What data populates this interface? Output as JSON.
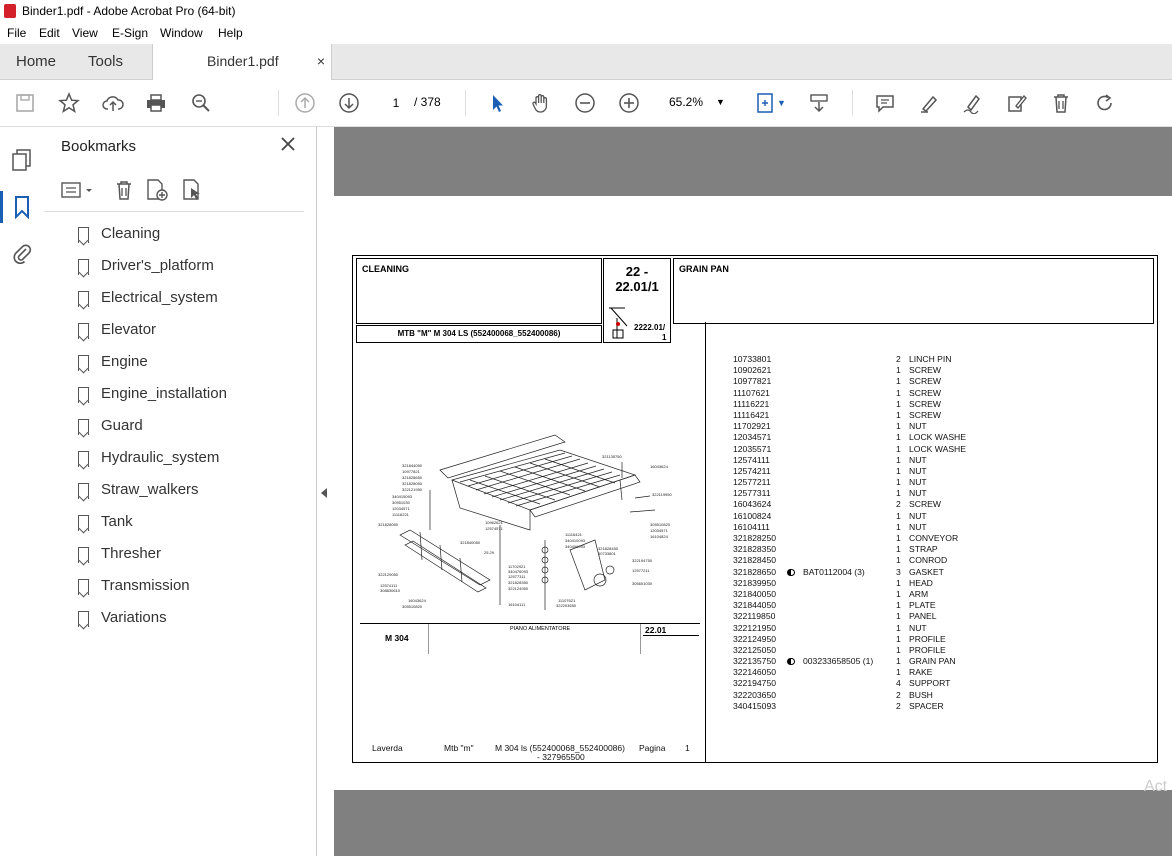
{
  "window": {
    "title": "Binder1.pdf - Adobe Acrobat Pro (64-bit)"
  },
  "menu": [
    "File",
    "Edit",
    "View",
    "E-Sign",
    "Window",
    "Help"
  ],
  "tabs": {
    "home": "Home",
    "tools": "Tools",
    "doc": "Binder1.pdf",
    "close": "×"
  },
  "toolbar": {
    "page_current": "1",
    "page_total": "/  378",
    "zoom": "65.2%"
  },
  "bookmarks": {
    "title": "Bookmarks",
    "items": [
      "Cleaning",
      "Driver's_platform",
      "Electrical_system",
      "Elevator",
      "Engine",
      "Engine_installation",
      "Guard",
      "Hydraulic_system",
      "Straw_walkers",
      "Tank",
      "Thresher",
      "Transmission",
      "Variations"
    ]
  },
  "sheet": {
    "group": "CLEANING",
    "code_top": "22 -",
    "code_bottom": "22.01/1",
    "title": "GRAIN PAN",
    "model": "MTB \"M\" M 304 LS (552400068_552400086)",
    "ref": "2222.01/",
    "ref2": "1",
    "drawing_model": "M 304",
    "drawing_title": "PIANO ALIMENTATORE",
    "drawing_code": "22.01",
    "footer": {
      "brand": "Laverda",
      "series": "Mtb \"m\"",
      "model": "M 304 ls (552400068_552400086)",
      "model2": "- 327965500",
      "page_label": "Pagina",
      "page_num": "1"
    }
  },
  "parts": [
    {
      "code": "10733801",
      "bat": "",
      "qty": "2",
      "desc": "LINCH PIN"
    },
    {
      "code": "10902621",
      "bat": "",
      "qty": "1",
      "desc": "SCREW"
    },
    {
      "code": "10977821",
      "bat": "",
      "qty": "1",
      "desc": "SCREW"
    },
    {
      "code": "11107621",
      "bat": "",
      "qty": "1",
      "desc": "SCREW"
    },
    {
      "code": "11116221",
      "bat": "",
      "qty": "1",
      "desc": "SCREW"
    },
    {
      "code": "11116421",
      "bat": "",
      "qty": "1",
      "desc": "SCREW"
    },
    {
      "code": "11702921",
      "bat": "",
      "qty": "1",
      "desc": "NUT"
    },
    {
      "code": "12034571",
      "bat": "",
      "qty": "1",
      "desc": "LOCK WASHE"
    },
    {
      "code": "12035571",
      "bat": "",
      "qty": "1",
      "desc": "LOCK WASHE"
    },
    {
      "code": "12574111",
      "bat": "",
      "qty": "1",
      "desc": "NUT"
    },
    {
      "code": "12574211",
      "bat": "",
      "qty": "1",
      "desc": "NUT"
    },
    {
      "code": "12577211",
      "bat": "",
      "qty": "1",
      "desc": "NUT"
    },
    {
      "code": "12577311",
      "bat": "",
      "qty": "1",
      "desc": "NUT"
    },
    {
      "code": "16043624",
      "bat": "",
      "qty": "2",
      "desc": "SCREW"
    },
    {
      "code": "16100824",
      "bat": "",
      "qty": "1",
      "desc": "NUT"
    },
    {
      "code": "16104111",
      "bat": "",
      "qty": "1",
      "desc": "NUT"
    },
    {
      "code": "321828250",
      "bat": "",
      "qty": "1",
      "desc": "CONVEYOR"
    },
    {
      "code": "321828350",
      "bat": "",
      "qty": "1",
      "desc": "STRAP"
    },
    {
      "code": "321828450",
      "bat": "",
      "qty": "1",
      "desc": "CONROD"
    },
    {
      "code": "321828650",
      "bat": "BAT0112004  (3)",
      "qty": "3",
      "desc": "GASKET"
    },
    {
      "code": "321839950",
      "bat": "",
      "qty": "1",
      "desc": "HEAD"
    },
    {
      "code": "321840050",
      "bat": "",
      "qty": "1",
      "desc": "ARM"
    },
    {
      "code": "321844050",
      "bat": "",
      "qty": "1",
      "desc": "PLATE"
    },
    {
      "code": "322119850",
      "bat": "",
      "qty": "1",
      "desc": "PANEL"
    },
    {
      "code": "322121950",
      "bat": "",
      "qty": "1",
      "desc": "NUT"
    },
    {
      "code": "322124950",
      "bat": "",
      "qty": "1",
      "desc": "PROFILE"
    },
    {
      "code": "322125050",
      "bat": "",
      "qty": "1",
      "desc": "PROFILE"
    },
    {
      "code": "322135750",
      "bat": "003233658505  (1)",
      "qty": "1",
      "desc": "GRAIN PAN"
    },
    {
      "code": "322146050",
      "bat": "",
      "qty": "1",
      "desc": "RAKE"
    },
    {
      "code": "322194750",
      "bat": "",
      "qty": "4",
      "desc": "SUPPORT"
    },
    {
      "code": "322203650",
      "bat": "",
      "qty": "2",
      "desc": "BUSH"
    },
    {
      "code": "340415093",
      "bat": "",
      "qty": "2",
      "desc": "SPACER"
    }
  ],
  "watermark": "Act"
}
